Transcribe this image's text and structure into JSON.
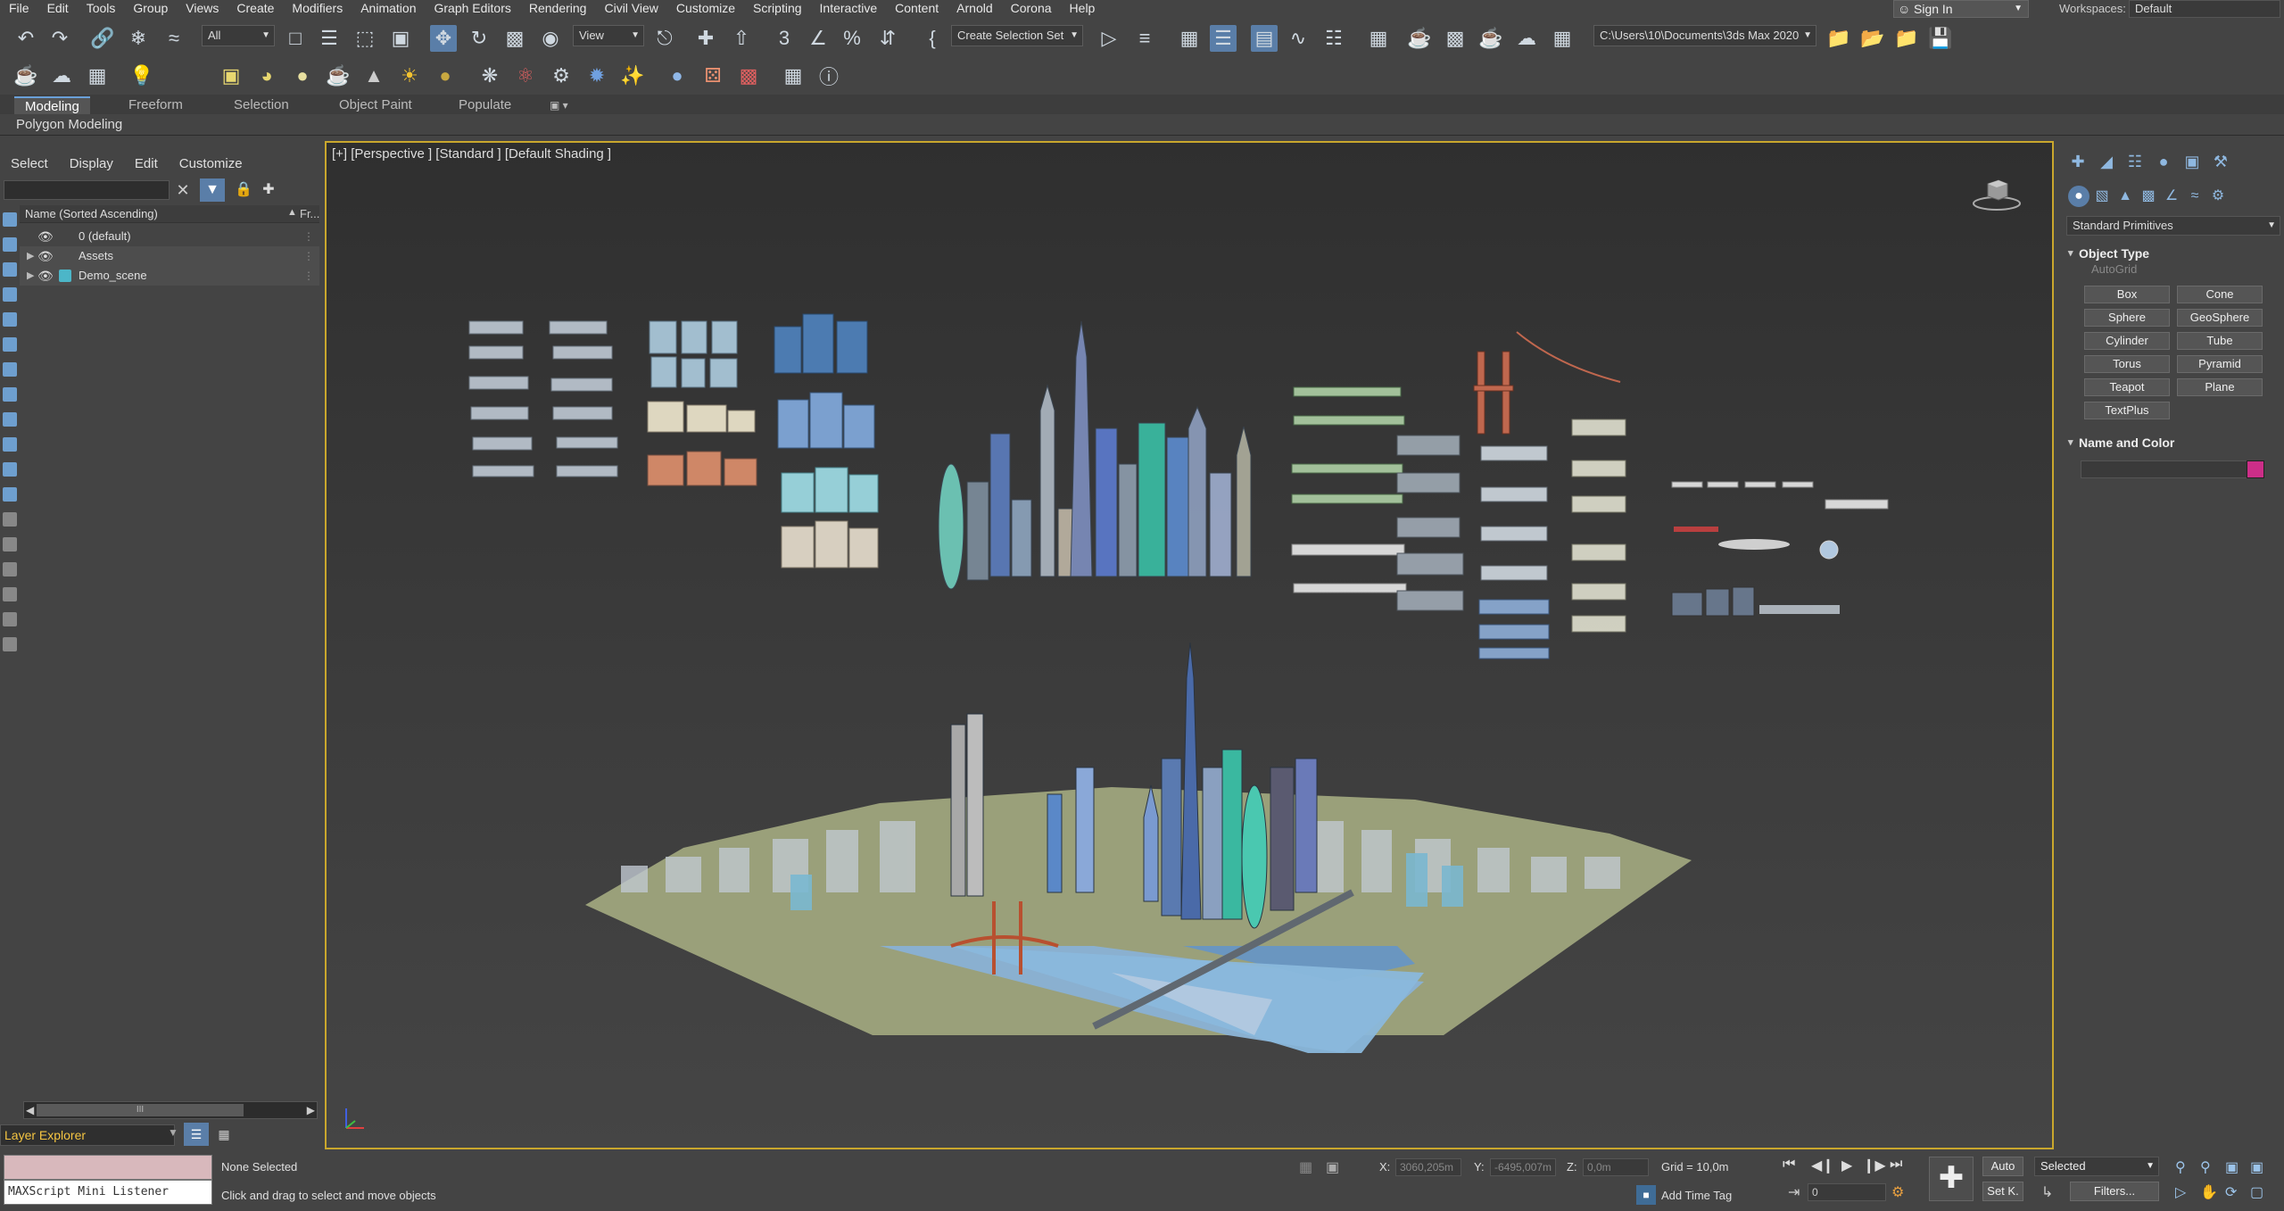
{
  "menu": [
    "File",
    "Edit",
    "Tools",
    "Group",
    "Views",
    "Create",
    "Modifiers",
    "Animation",
    "Graph Editors",
    "Rendering",
    "Civil View",
    "Customize",
    "Scripting",
    "Interactive",
    "Content",
    "Arnold",
    "Corona",
    "Help"
  ],
  "signin": "Sign In",
  "workspaces": {
    "label": "Workspaces:",
    "value": "Default"
  },
  "toolbar1": {
    "filter_select": "All",
    "coord_select": "View",
    "selection_set": "Create Selection Set",
    "project_path": "C:\\Users\\10\\Documents\\3ds Max 2020"
  },
  "ribbon": {
    "tabs": [
      "Modeling",
      "Freeform",
      "Selection",
      "Object Paint",
      "Populate"
    ],
    "panel_label": "Polygon Modeling"
  },
  "explorer": {
    "menu": [
      "Select",
      "Display",
      "Edit",
      "Customize"
    ],
    "column_name": "Name (Sorted Ascending)",
    "column_frozen": "Fr...",
    "rows": [
      {
        "label": "0 (default)"
      },
      {
        "label": "Assets"
      },
      {
        "label": "Demo_scene"
      }
    ],
    "scroll_thumb": "III",
    "footer_label": "Layer Explorer"
  },
  "viewport": {
    "label": "[+] [Perspective ] [Standard ] [Default Shading ]"
  },
  "command_panel": {
    "dropdown": "Standard Primitives",
    "object_type_title": "Object Type",
    "autogrid": "AutoGrid",
    "primitives": [
      "Box",
      "Cone",
      "Sphere",
      "GeoSphere",
      "Cylinder",
      "Tube",
      "Torus",
      "Pyramid",
      "Teapot",
      "Plane",
      "TextPlus"
    ],
    "name_color_title": "Name and Color",
    "object_color": "#cc2e88"
  },
  "status": {
    "maxscript": "MAXScript Mini Listener",
    "selection": "None Selected",
    "prompt": "Click and drag to select and move objects",
    "x_label": "X:",
    "x_value": "3060,205m",
    "y_label": "Y:",
    "y_value": "-6495,007m",
    "z_label": "Z:",
    "z_value": "0,0m",
    "grid": "Grid = 10,0m",
    "add_time_tag": "Add Time Tag",
    "frame": "0",
    "auto_key": "Auto",
    "set_key": "Set K.",
    "key_filter": "Selected",
    "filters": "Filters..."
  }
}
